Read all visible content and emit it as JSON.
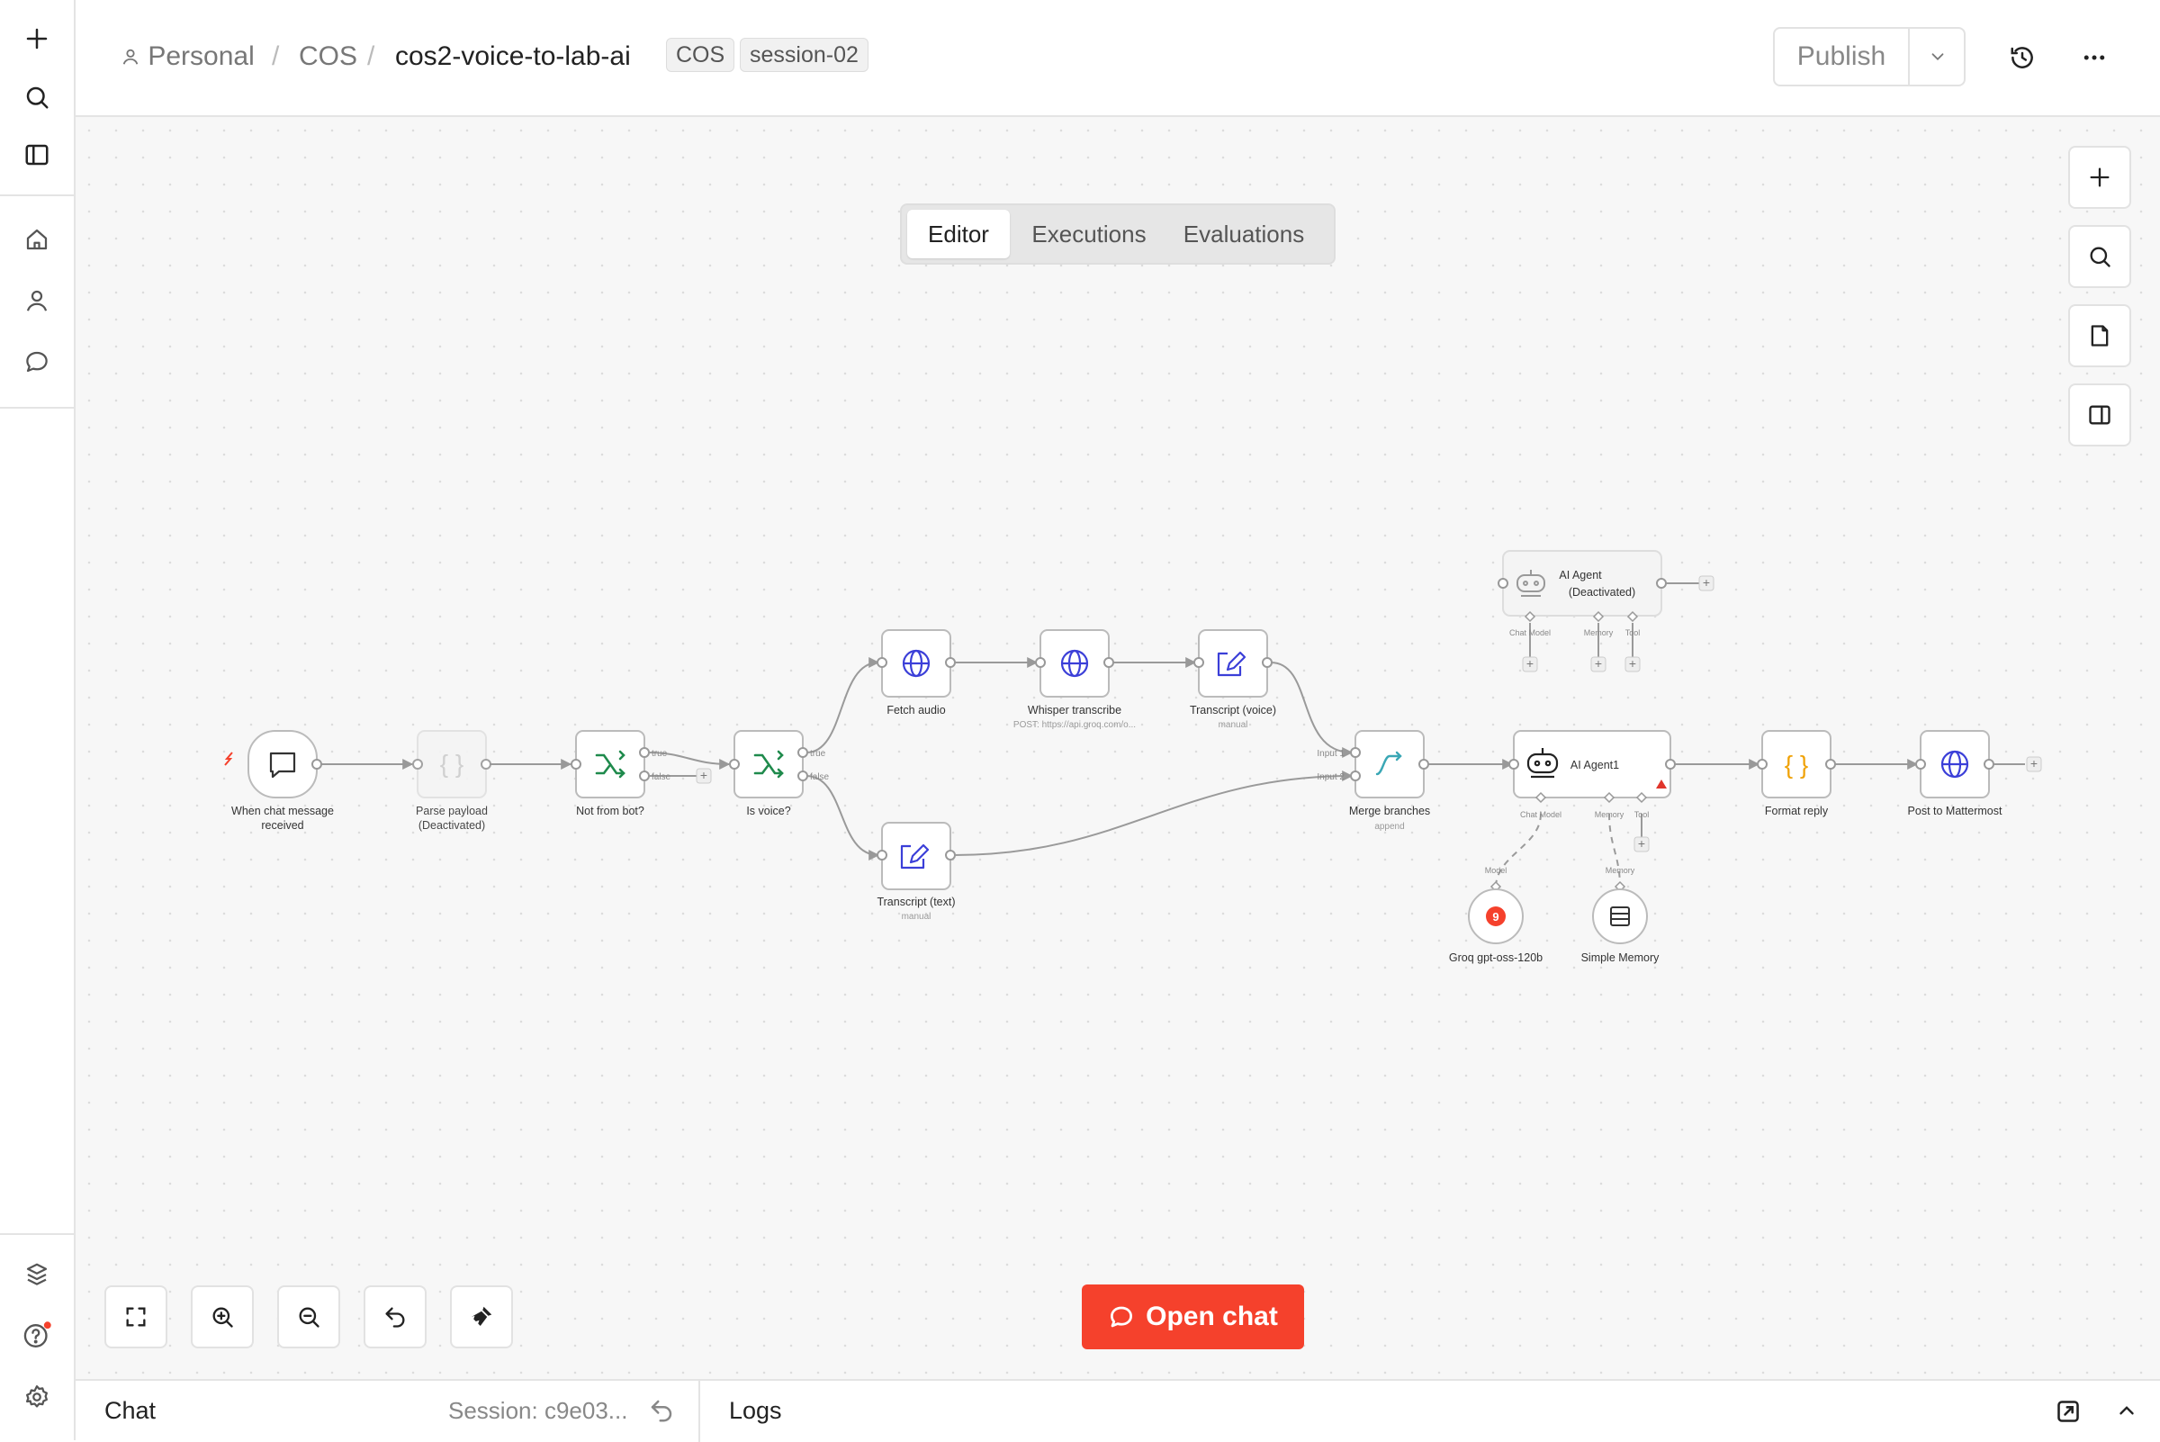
{
  "breadcrumb": {
    "personal": "Personal",
    "project": "COS",
    "workflow": "cos2-voice-to-lab-ai",
    "tags": [
      "COS",
      "session-02"
    ]
  },
  "header": {
    "publish_label": "Publish"
  },
  "tabs": [
    {
      "label": "Editor",
      "active": true
    },
    {
      "label": "Executions",
      "active": false
    },
    {
      "label": "Evaluations",
      "active": false
    }
  ],
  "nodes": {
    "trigger": {
      "title": "When chat message",
      "title2": "received"
    },
    "parse": {
      "title": "Parse payload",
      "title2": "(Deactivated)"
    },
    "not_from_bot": {
      "title": "Not from bot?",
      "out_true": "true",
      "out_false": "false"
    },
    "is_voice": {
      "title": "Is voice?",
      "out_true": "true",
      "out_false": "false"
    },
    "fetch_audio": {
      "title": "Fetch audio"
    },
    "whisper": {
      "title": "Whisper transcribe",
      "subtitle": "POST: https://api.groq.com/o..."
    },
    "transcript_voice": {
      "title": "Transcript (voice)",
      "subtitle": "manual"
    },
    "transcript_text": {
      "title": "Transcript (text)",
      "subtitle": "manual"
    },
    "merge": {
      "title": "Merge branches",
      "subtitle": "append",
      "input1": "Input 1",
      "input2": "Input 2"
    },
    "agent_deact": {
      "title": "AI Agent",
      "title2": "(Deactivated)",
      "port_model": "Chat Model",
      "port_memory": "Memory",
      "port_tool": "Tool"
    },
    "agent1": {
      "title": "AI Agent1",
      "port_model": "Chat Model",
      "port_memory": "Memory",
      "port_tool": "Tool"
    },
    "groq": {
      "title": "Groq gpt-oss-120b",
      "edge_label": "Model",
      "icon_text": "9"
    },
    "memory": {
      "title": "Simple Memory",
      "edge_label": "Memory"
    },
    "format_reply": {
      "title": "Format reply"
    },
    "post_mm": {
      "title": "Post to Mattermost"
    }
  },
  "open_chat_label": "Open chat",
  "bottom": {
    "chat_label": "Chat",
    "session_label": "Session: c9e03...",
    "logs_label": "Logs"
  },
  "colors": {
    "accent": "#f5412c",
    "http_blue": "#3b3fd8",
    "if_green": "#1f8a4c",
    "merge_teal": "#3aa7b5",
    "code_orange": "#f0a30a",
    "warning_red": "#e0352b"
  }
}
